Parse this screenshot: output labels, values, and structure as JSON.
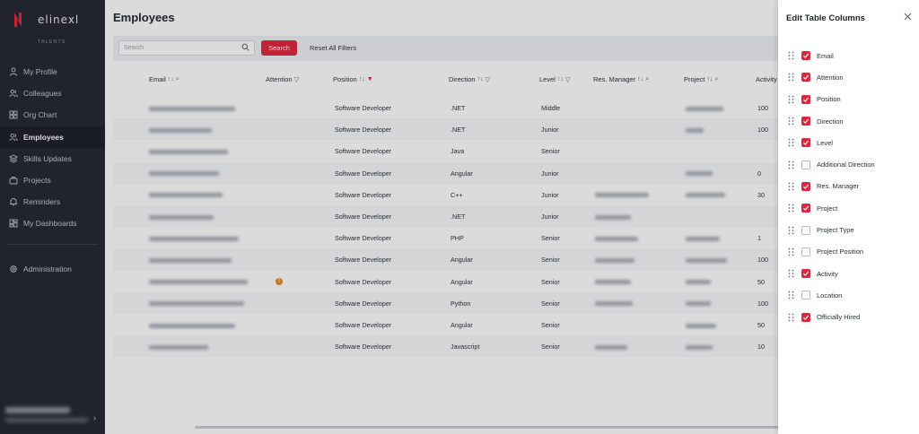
{
  "app": {
    "logo_text": "elinexl",
    "logo_sub": "TALENTS",
    "collapse_icon": "chevron-left-icon"
  },
  "sidebar": {
    "items": [
      {
        "label": "My Profile",
        "icon": "user-icon",
        "active": false
      },
      {
        "label": "Colleagues",
        "icon": "users-icon",
        "active": false
      },
      {
        "label": "Org Chart",
        "icon": "grid-icon",
        "active": false
      },
      {
        "label": "Employees",
        "icon": "users-icon",
        "active": true
      },
      {
        "label": "Skills Updates",
        "icon": "layers-icon",
        "active": false
      },
      {
        "label": "Projects",
        "icon": "briefcase-icon",
        "active": false
      },
      {
        "label": "Reminders",
        "icon": "bell-icon",
        "active": false
      },
      {
        "label": "My Dashboards",
        "icon": "dashboard-icon",
        "active": false
      }
    ],
    "admin": {
      "label": "Administration",
      "icon": "gear-icon"
    }
  },
  "main": {
    "title": "Employees",
    "search": {
      "placeholder": "Search",
      "button": "Search"
    },
    "reset": "Reset All Filters",
    "columns": {
      "email": "Email",
      "attention": "Attention",
      "position": "Position",
      "direction": "Direction",
      "level": "Level",
      "res_manager": "Res. Manager",
      "project": "Project",
      "activity": "Activity"
    },
    "rows": [
      {
        "position": "Software Developer",
        "direction": ".NET",
        "level": "Middle",
        "activity": "100",
        "attention": false,
        "has_manager": false,
        "has_project": true
      },
      {
        "position": "Software Developer",
        "direction": ".NET",
        "level": "Junior",
        "activity": "100",
        "attention": false,
        "has_manager": true,
        "has_project": true
      },
      {
        "position": "Software Developer",
        "direction": "Java",
        "level": "Senior",
        "activity": "",
        "attention": false,
        "has_manager": false,
        "has_project": false
      },
      {
        "position": "Software Developer",
        "direction": "Angular",
        "level": "Junior",
        "activity": "0",
        "attention": false,
        "has_manager": false,
        "has_project": true
      },
      {
        "position": "Software Developer",
        "direction": "C++",
        "level": "Junior",
        "activity": "30",
        "attention": false,
        "has_manager": true,
        "has_project": true
      },
      {
        "position": "Software Developer",
        "direction": ".NET",
        "level": "Junior",
        "activity": "",
        "attention": false,
        "has_manager": true,
        "has_project": false
      },
      {
        "position": "Software Developer",
        "direction": "PHP",
        "level": "Senior",
        "activity": "1",
        "attention": false,
        "has_manager": true,
        "has_project": true
      },
      {
        "position": "Software Developer",
        "direction": "Angular",
        "level": "Senior",
        "activity": "100",
        "attention": false,
        "has_manager": true,
        "has_project": true
      },
      {
        "position": "Software Developer",
        "direction": "Angular",
        "level": "Senior",
        "activity": "50",
        "attention": true,
        "has_manager": true,
        "has_project": true
      },
      {
        "position": "Software Developer",
        "direction": "Python",
        "level": "Senior",
        "activity": "100",
        "attention": false,
        "has_manager": true,
        "has_project": true
      },
      {
        "position": "Software Developer",
        "direction": "Angular",
        "level": "Senior",
        "activity": "50",
        "attention": false,
        "has_manager": false,
        "has_project": true
      },
      {
        "position": "Software Developer",
        "direction": "Javascript",
        "level": "Senior",
        "activity": "10",
        "attention": false,
        "has_manager": true,
        "has_project": true
      }
    ]
  },
  "panel": {
    "title": "Edit Table Columns",
    "close_icon": "close-icon",
    "columns": [
      {
        "label": "Email",
        "checked": true
      },
      {
        "label": "Attention",
        "checked": true
      },
      {
        "label": "Position",
        "checked": true
      },
      {
        "label": "Direction",
        "checked": true
      },
      {
        "label": "Level",
        "checked": true
      },
      {
        "label": "Additional Direction",
        "checked": false
      },
      {
        "label": "Res. Manager",
        "checked": true
      },
      {
        "label": "Project",
        "checked": true
      },
      {
        "label": "Project Type",
        "checked": false
      },
      {
        "label": "Project Position",
        "checked": false
      },
      {
        "label": "Activity",
        "checked": true
      },
      {
        "label": "Location",
        "checked": false
      },
      {
        "label": "Officially Hired",
        "checked": true
      }
    ]
  },
  "colors": {
    "accent": "#e0243a",
    "sidebar_bg": "#22262e",
    "attention": "#e8891c"
  }
}
